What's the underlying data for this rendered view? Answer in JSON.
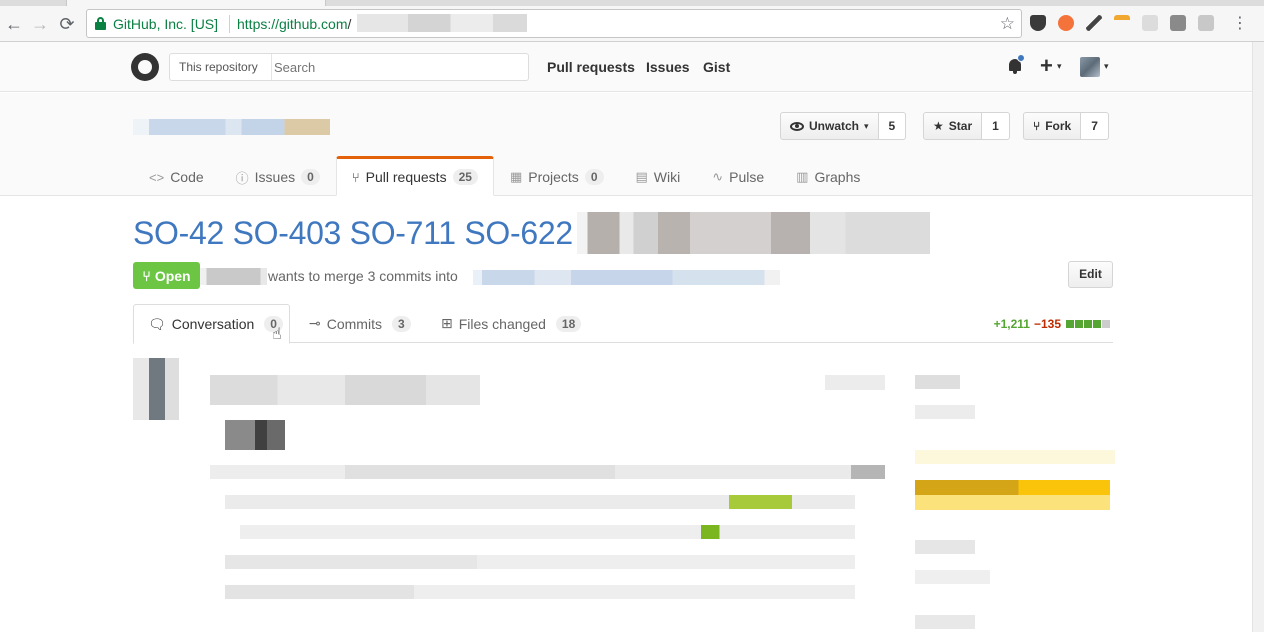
{
  "browser": {
    "ev_label": "GitHub, Inc. [US]",
    "url_host": "https://github.com",
    "url_path": "/",
    "icons": [
      "back-icon",
      "forward-icon",
      "reload-icon",
      "lock-icon",
      "bookmark-star-icon"
    ],
    "nav_back": "←",
    "nav_forward": "→",
    "nav_reload": "⟳",
    "star_glyph": "☆"
  },
  "header": {
    "search_scope": "This repository",
    "search_placeholder": "Search",
    "nav": [
      "Pull requests",
      "Issues",
      "Gist"
    ],
    "plus": "+",
    "caret": "▾"
  },
  "repo": {
    "actions": [
      {
        "label": "Unwatch",
        "count": "5"
      },
      {
        "label": "Star",
        "count": "1"
      },
      {
        "label": "Fork",
        "count": "7"
      }
    ],
    "tabs": [
      {
        "icon": "<>",
        "label": "Code",
        "count": ""
      },
      {
        "icon": "ⓘ",
        "label": "Issues",
        "count": "0"
      },
      {
        "icon": "⑂",
        "label": "Pull requests",
        "count": "25"
      },
      {
        "icon": "▦",
        "label": "Projects",
        "count": "0"
      },
      {
        "icon": "▤",
        "label": "Wiki",
        "count": ""
      },
      {
        "icon": "∿",
        "label": "Pulse",
        "count": ""
      },
      {
        "icon": "▥",
        "label": "Graphs",
        "count": ""
      }
    ]
  },
  "pr": {
    "title": "SO-42 SO-403 SO-711 SO-622",
    "edit_label": "Edit",
    "state": "Open",
    "merge_text": "wants to merge 3 commits into",
    "tabs": [
      {
        "label": "Conversation",
        "count": "0"
      },
      {
        "label": "Commits",
        "count": "3"
      },
      {
        "label": "Files changed",
        "count": "18"
      }
    ],
    "additions": "+1,211",
    "deletions": "−135",
    "diffstat_blocks": [
      "#55a532",
      "#55a532",
      "#55a532",
      "#55a532",
      "#cccccc"
    ]
  }
}
